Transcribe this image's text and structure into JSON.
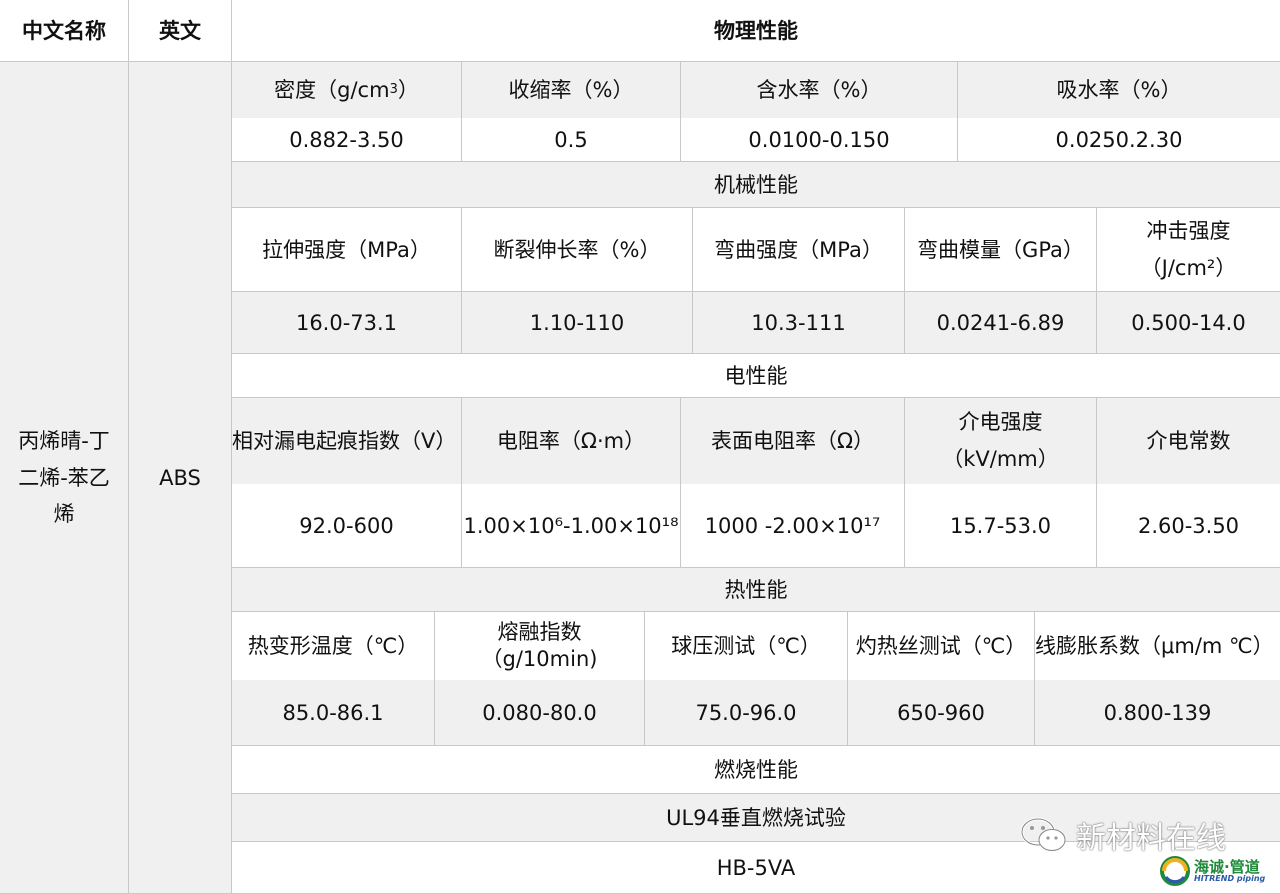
{
  "header": {
    "col_chinese": "中文名称",
    "col_english": "英文",
    "col_physical": "物理性能"
  },
  "material": {
    "chinese_name": "丙烯晴-丁二烯-苯乙烯",
    "english_name": "ABS"
  },
  "physical": {
    "headers": [
      "密度（g/cm³）",
      "收缩率（%）",
      "含水率（%）",
      "吸水率（%）"
    ],
    "values": [
      "0.882-3.50",
      "0.5",
      "0.0100-0.150",
      "0.0250.2.30"
    ]
  },
  "mechanical": {
    "title": "机械性能",
    "headers": [
      "拉伸强度（MPa）",
      "断裂伸长率（%）",
      "弯曲强度（MPa）",
      "弯曲模量（GPa）",
      "冲击强度（J/cm²）"
    ],
    "values": [
      "16.0-73.1",
      "1.10-110",
      "10.3-111",
      "0.0241-6.89",
      "0.500-14.0"
    ]
  },
  "electrical": {
    "title": "电性能",
    "headers": [
      "相对漏电起痕指数（V）",
      "电阻率（Ω·m）",
      "表面电阻率（Ω）",
      "介电强度（kV/mm）",
      "介电常数"
    ],
    "values": [
      "92.0-600",
      "1.00×10⁶-1.00×10¹⁸",
      "1000 -2.00×10¹⁷",
      "15.7-53.0",
      "2.60-3.50"
    ]
  },
  "thermal": {
    "title": "热性能",
    "headers": [
      "热变形温度（℃）",
      "熔融指数（g/10min)",
      "球压测试（℃）",
      "灼热丝测试（℃）",
      "线膨胀系数（μm/m ℃）"
    ],
    "values": [
      "85.0-86.1",
      "0.080-80.0",
      "75.0-96.0",
      "650-960",
      "0.800-139"
    ]
  },
  "combustion": {
    "title": "燃烧性能",
    "test": "UL94垂直燃烧试验",
    "result": "HB-5VA"
  },
  "watermark": {
    "text": "新材料在线",
    "icon": "wechat-icon"
  },
  "logo": {
    "name": "海诚·管道",
    "sub": "HITREND piping",
    "icon": "hitrend-logo-icon"
  }
}
